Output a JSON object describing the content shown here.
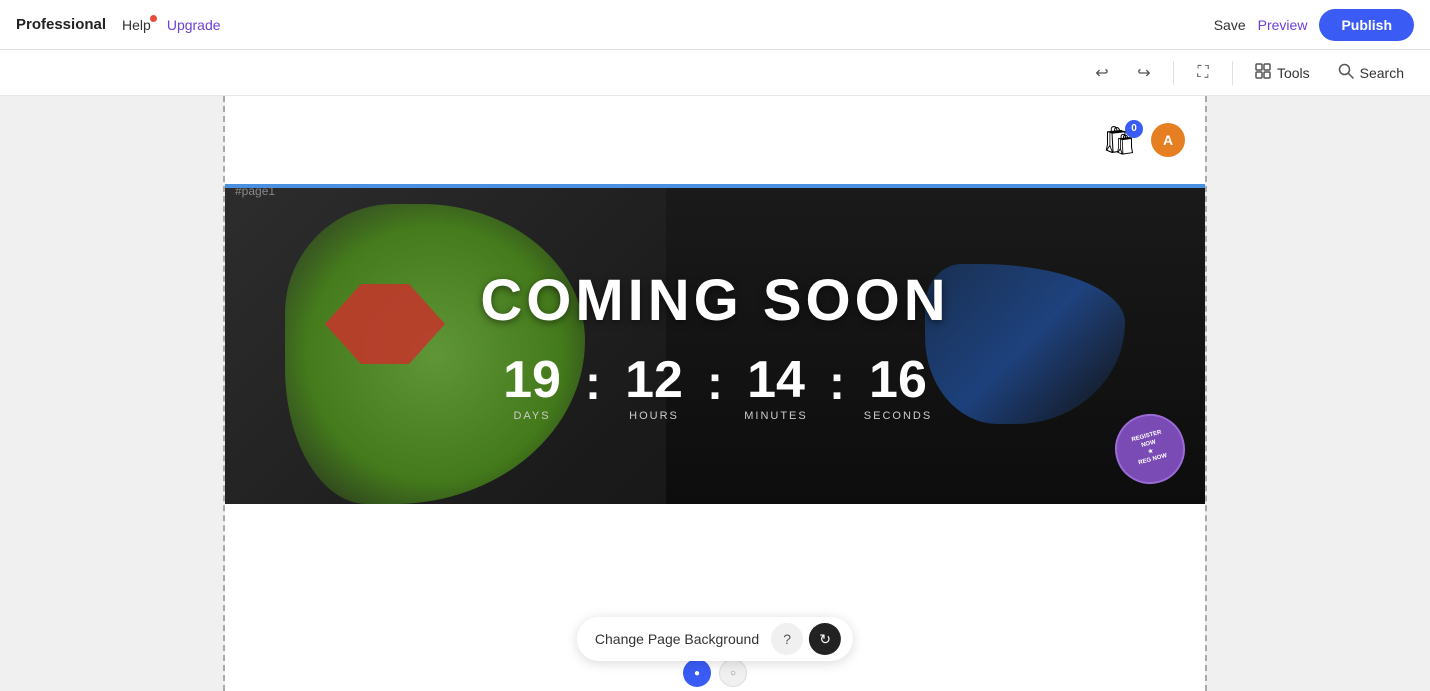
{
  "topbar": {
    "brand": "Professional",
    "help_label": "Help",
    "upgrade_label": "Upgrade",
    "save_label": "Save",
    "preview_label": "Preview",
    "publish_label": "Publish"
  },
  "toolbar": {
    "undo_icon": "↩",
    "redo_icon": "↪",
    "compress_icon": "⛶",
    "tools_icon": "□",
    "tools_label": "Tools",
    "search_icon": "🔍",
    "search_label": "Search"
  },
  "canvas": {
    "page_label": "#page1",
    "cart_count": "0",
    "avatar_letter": "A"
  },
  "countdown": {
    "title": "COMING SOON",
    "days_value": "19",
    "days_label": "DAYS",
    "hours_value": "12",
    "hours_label": "HOURS",
    "minutes_value": "14",
    "minutes_label": "MINUTES",
    "seconds_value": "16",
    "seconds_label": "SECONDS"
  },
  "bottom_toolbar": {
    "change_bg_label": "Change Page Background",
    "help_icon": "?",
    "refresh_icon": "↻"
  },
  "stamp": {
    "text": "REGISTER NOW\n★\nREG NOW"
  }
}
